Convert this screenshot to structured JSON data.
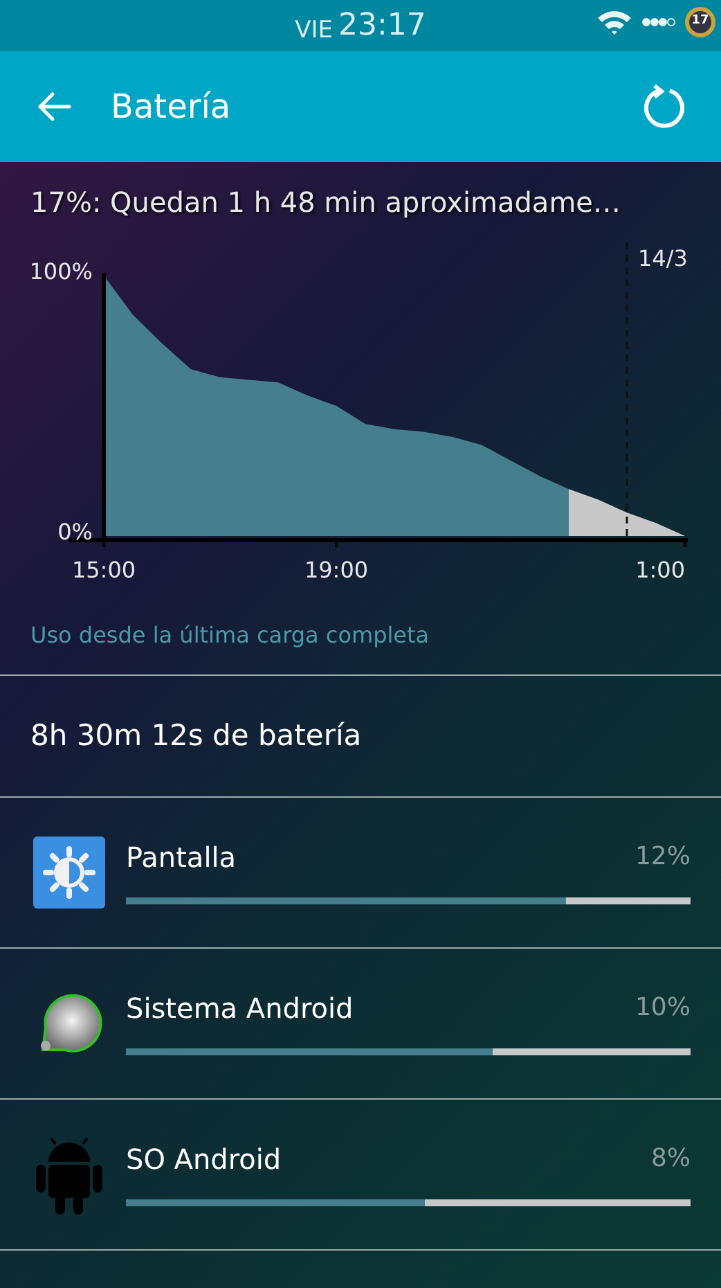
{
  "status_bar": {
    "day": "VIE",
    "time": "23:17",
    "battery": "17"
  },
  "header": {
    "title": "Batería"
  },
  "summary": "17%: Quedan 1 h 48 min aproximadame…",
  "chart_data": {
    "type": "area",
    "categories": [
      "15:00",
      null,
      null,
      null,
      null,
      null,
      null,
      null,
      "19:00",
      null,
      null,
      null,
      null,
      null,
      null,
      null,
      null,
      null,
      null,
      null,
      "1:00"
    ],
    "series": [
      {
        "color": "#457f8d",
        "values": [
          100,
          85,
          74,
          64,
          61,
          60,
          59,
          54,
          50,
          43,
          41,
          40,
          38,
          35,
          29,
          23,
          18,
          null,
          null,
          null,
          null
        ]
      },
      {
        "color": "#c8c8c8",
        "values": [
          null,
          null,
          null,
          null,
          null,
          null,
          null,
          null,
          null,
          null,
          null,
          null,
          null,
          null,
          null,
          null,
          18,
          14,
          9,
          5,
          0
        ]
      }
    ],
    "ylim": [
      0,
      100
    ],
    "yticks": [
      {
        "value": 0,
        "label": "0%"
      },
      {
        "value": 100,
        "label": "100%"
      }
    ],
    "annotations": [
      "14/3"
    ]
  },
  "chart_caption": "Uso desde la última carga completa",
  "usage_title": "8h 30m 12s de batería",
  "apps": [
    {
      "kind": "display",
      "name": "Pantalla",
      "percent": "12%",
      "level": 0.78
    },
    {
      "kind": "system",
      "name": "Sistema Android",
      "percent": "10%",
      "level": 0.65
    },
    {
      "kind": "android",
      "name": "SO Android",
      "percent": "8%",
      "level": 0.53
    }
  ]
}
